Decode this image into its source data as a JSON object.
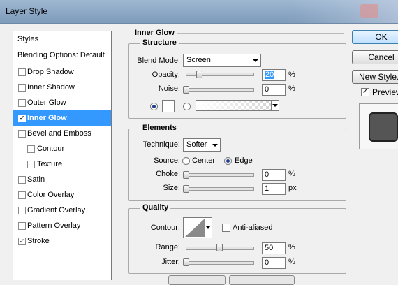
{
  "window": {
    "title": "Layer Style"
  },
  "styles_panel": {
    "header": "Styles",
    "blending": "Blending Options: Default",
    "items": [
      {
        "label": "Drop Shadow",
        "checked": false,
        "indent": false,
        "selected": false
      },
      {
        "label": "Inner Shadow",
        "checked": false,
        "indent": false,
        "selected": false
      },
      {
        "label": "Outer Glow",
        "checked": false,
        "indent": false,
        "selected": false
      },
      {
        "label": "Inner Glow",
        "checked": true,
        "indent": false,
        "selected": true
      },
      {
        "label": "Bevel and Emboss",
        "checked": false,
        "indent": false,
        "selected": false
      },
      {
        "label": "Contour",
        "checked": false,
        "indent": true,
        "selected": false
      },
      {
        "label": "Texture",
        "checked": false,
        "indent": true,
        "selected": false
      },
      {
        "label": "Satin",
        "checked": false,
        "indent": false,
        "selected": false
      },
      {
        "label": "Color Overlay",
        "checked": false,
        "indent": false,
        "selected": false
      },
      {
        "label": "Gradient Overlay",
        "checked": false,
        "indent": false,
        "selected": false
      },
      {
        "label": "Pattern Overlay",
        "checked": false,
        "indent": false,
        "selected": false
      },
      {
        "label": "Stroke",
        "checked": true,
        "indent": false,
        "selected": false
      }
    ],
    "check_glyph": "✓"
  },
  "inner_glow": {
    "title": "Inner Glow",
    "structure": {
      "title": "Structure",
      "blend_mode_label": "Blend Mode:",
      "blend_mode_value": "Screen",
      "opacity_label": "Opacity:",
      "opacity_value": "20",
      "opacity_level": 0.2,
      "noise_label": "Noise:",
      "noise_value": "0",
      "noise_level": 0,
      "percent": "%"
    },
    "elements": {
      "title": "Elements",
      "technique_label": "Technique:",
      "technique_value": "Softer",
      "source_label": "Source:",
      "source_center": "Center",
      "source_edge": "Edge",
      "choke_label": "Choke:",
      "choke_value": "0",
      "choke_level": 0,
      "size_label": "Size:",
      "size_value": "1",
      "size_level": 0.005,
      "size_unit": "px",
      "percent": "%"
    },
    "quality": {
      "title": "Quality",
      "contour_label": "Contour:",
      "anti_aliased_label": "Anti-aliased",
      "range_label": "Range:",
      "range_value": "50",
      "range_level": 0.5,
      "jitter_label": "Jitter:",
      "jitter_value": "0",
      "jitter_level": 0,
      "percent": "%"
    }
  },
  "buttons": {
    "ok": "OK",
    "cancel": "Cancel",
    "new_style": "New Style...",
    "preview_label": "Preview",
    "preview_checked": true
  },
  "colors": {
    "selection": "#3399ff",
    "preview_swatch": "#555555"
  }
}
